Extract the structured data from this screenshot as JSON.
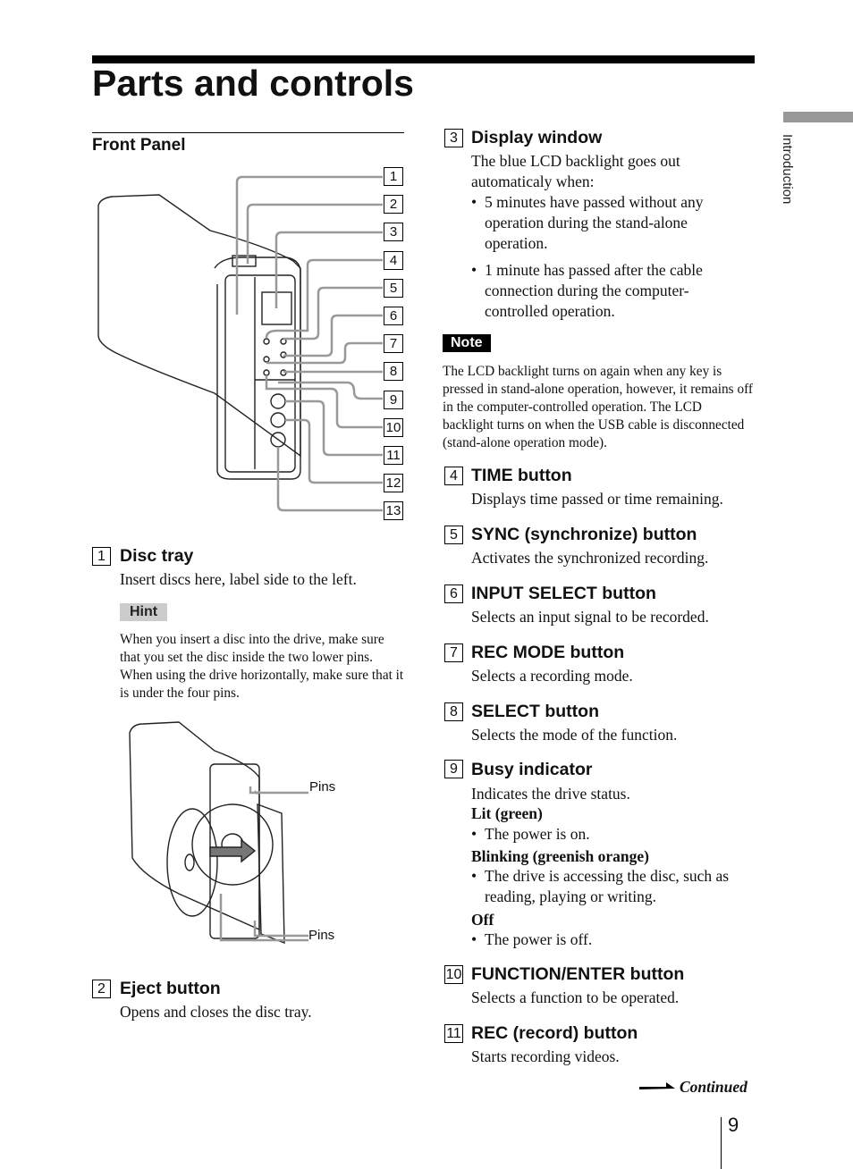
{
  "page_title": "Parts and controls",
  "section": "Front Panel",
  "side_tab": "Introduction",
  "page_number": "9",
  "continued": "Continued",
  "figure1_callouts": [
    "1",
    "2",
    "3",
    "4",
    "5",
    "6",
    "7",
    "8",
    "9",
    "10",
    "11",
    "12",
    "13"
  ],
  "figure2_labels": [
    "Pins",
    "Pins"
  ],
  "hint_label": "Hint",
  "hint_text": "When you insert a disc into the drive, make sure that you set the disc inside the two lower pins. When using the drive horizontally, make sure that it is under the four pins.",
  "note_label": "Note",
  "note_text": "The LCD backlight turns on again when any key is pressed in stand-alone operation, however, it remains off in the computer-controlled operation. The LCD backlight turns on when the USB cable is disconnected  (stand-alone operation mode).",
  "items": [
    {
      "num": "1",
      "title": "Disc tray",
      "desc": "Insert discs here, label side to the left."
    },
    {
      "num": "2",
      "title": "Eject button",
      "desc": "Opens and closes the disc tray."
    },
    {
      "num": "3",
      "title": "Display window",
      "desc": "The blue LCD backlight goes out automaticaly when:",
      "bullets": [
        "5 minutes have passed without any operation during the stand-alone operation.",
        "1 minute has passed after the cable connection during the computer-controlled operation."
      ]
    },
    {
      "num": "4",
      "title": "TIME button",
      "desc": "Displays time passed or time remaining."
    },
    {
      "num": "5",
      "title": "SYNC (synchronize) button",
      "desc": "Activates the synchronized recording."
    },
    {
      "num": "6",
      "title": "INPUT SELECT button",
      "desc": "Selects an input signal to be recorded."
    },
    {
      "num": "7",
      "title": "REC MODE button",
      "desc": "Selects a recording mode."
    },
    {
      "num": "8",
      "title": "SELECT button",
      "desc": "Selects the mode of the function."
    },
    {
      "num": "9",
      "title": "Busy indicator",
      "desc": "Indicates the drive status.",
      "states": [
        {
          "label": "Lit (green)",
          "bullet": "The power is on."
        },
        {
          "label": "Blinking (greenish orange)",
          "bullet": "The drive is accessing the disc, such as reading, playing or writing."
        },
        {
          "label": "Off",
          "bullet": "The power is off."
        }
      ]
    },
    {
      "num": "10",
      "title": "FUNCTION/ENTER button",
      "desc": "Selects a function to be operated."
    },
    {
      "num": "11",
      "title": "REC (record) button",
      "desc": "Starts recording videos."
    }
  ]
}
